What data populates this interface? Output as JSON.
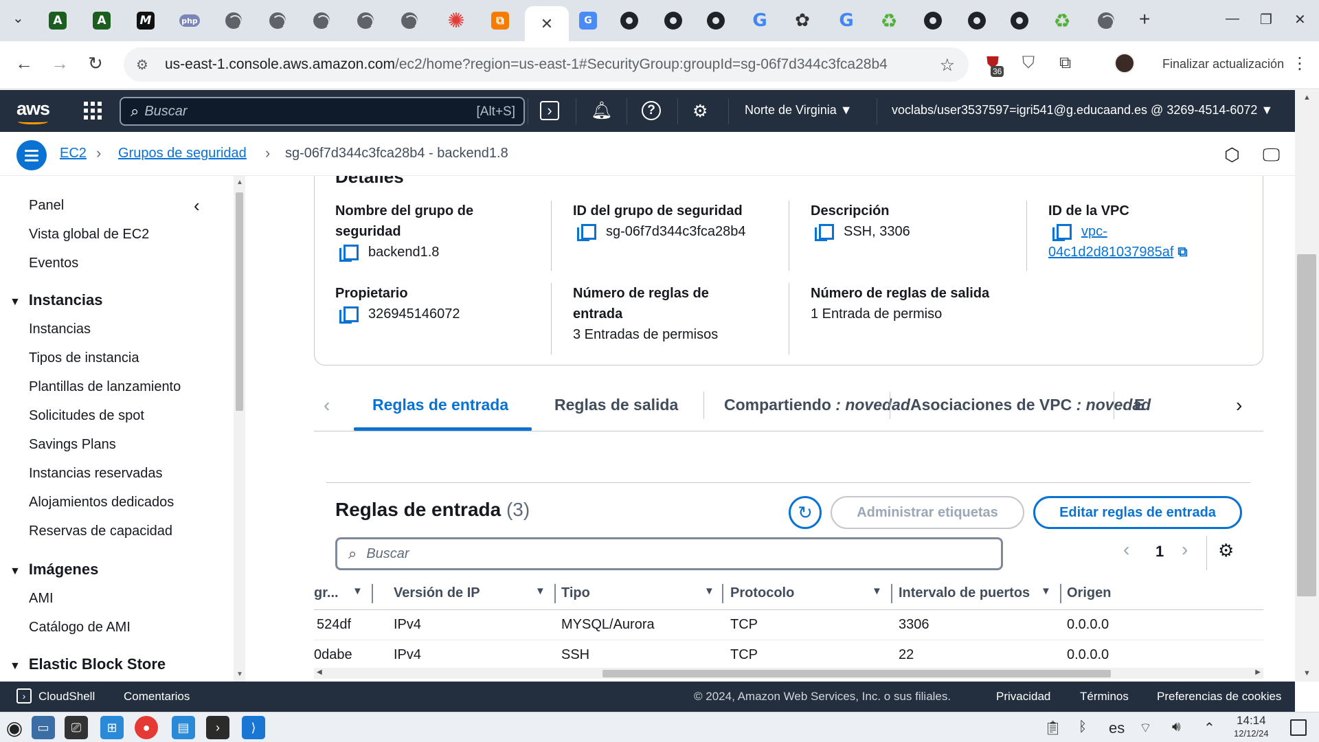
{
  "browser": {
    "tabs": [
      {
        "icon": "letter-a-green-icon",
        "text": "A"
      },
      {
        "icon": "letter-a-green-icon",
        "text": "A"
      },
      {
        "icon": "letter-m-icon",
        "text": "M"
      },
      {
        "icon": "php-icon",
        "text": "php"
      },
      {
        "icon": "globe-icon",
        "text": ""
      },
      {
        "icon": "globe-icon",
        "text": ""
      },
      {
        "icon": "globe-icon",
        "text": ""
      },
      {
        "icon": "globe-icon",
        "text": ""
      },
      {
        "icon": "globe-icon",
        "text": ""
      },
      {
        "icon": "red-gear-icon",
        "text": "✺"
      },
      {
        "icon": "orange-square-icon",
        "text": "⧉"
      }
    ],
    "active_tab_close": "✕",
    "url_host": "us-east-1.console.aws.amazon.com",
    "url_rest": "/ec2/home?region=us-east-1#SecurityGroup:groupId=sg-06f7d344c3fca28b4",
    "ext_badge": "36",
    "update_label": "Finalizar actualización"
  },
  "aws": {
    "logo": "aws",
    "search_placeholder": "Buscar",
    "search_shortcut": "[Alt+S]",
    "region": "Norte de Virginia ▼",
    "account": "voclabs/user3537597=igri541@g.educaand.es @ 3269-4514-6072 ▼"
  },
  "breadcrumb": {
    "ec2": "EC2",
    "groups": "Grupos de seguridad",
    "current": "sg-06f7d344c3fca28b4 - backend1.8"
  },
  "sidebar": {
    "items_top": [
      "Panel",
      "Vista global de EC2",
      "Eventos"
    ],
    "section_instances": "Instancias",
    "instances_items": [
      "Instancias",
      "Tipos de instancia",
      "Plantillas de lanzamiento",
      "Solicitudes de spot",
      "Savings Plans",
      "Instancias reservadas",
      "Alojamientos dedicados",
      "Reservas de capacidad"
    ],
    "section_images": "Imágenes",
    "images_items": [
      "AMI",
      "Catálogo de AMI"
    ],
    "section_ebs": "Elastic Block Store"
  },
  "details": {
    "heading": "Detalles",
    "name_label_1": "Nombre del grupo de",
    "name_label_2": "seguridad",
    "name_value": "backend1.8",
    "sgid_label": "ID del grupo de seguridad",
    "sgid_value": "sg-06f7d344c3fca28b4",
    "desc_label": "Descripción",
    "desc_value": "SSH, 3306",
    "vpc_label": "ID de la VPC",
    "vpc_value_1": "vpc-",
    "vpc_value_2": "04c1d2d81037985af",
    "owner_label": "Propietario",
    "owner_value": "326945146072",
    "inrules_label_1": "Número de reglas de",
    "inrules_label_2": "entrada",
    "inrules_value": "3 Entradas de permisos",
    "outrules_label": "Número de reglas de salida",
    "outrules_value": "1 Entrada de permiso"
  },
  "tabs": {
    "inbound": "Reglas de entrada",
    "outbound": "Reglas de salida",
    "sharing": "Compartiendo",
    "sharing_tag": ": novedad",
    "vpc_assoc": "Asociaciones de VPC",
    "vpc_assoc_tag": ": novedad",
    "cut": "E"
  },
  "rules": {
    "title": "Reglas de entrada",
    "count": "(3)",
    "manage_tags": "Administrar etiquetas",
    "edit_rules": "Editar reglas de entrada",
    "search_placeholder": "Buscar",
    "page": "1",
    "columns": [
      "gr...",
      "Versión de IP",
      "Tipo",
      "Protocolo",
      "Intervalo de puertos",
      "Origen"
    ],
    "rows": [
      [
        "524df",
        "IPv4",
        "MYSQL/Aurora",
        "TCP",
        "3306",
        "0.0.0.0"
      ],
      [
        "0dabe",
        "IPv4",
        "SSH",
        "TCP",
        "22",
        "0.0.0.0"
      ]
    ]
  },
  "footer": {
    "cloudshell": "CloudShell",
    "feedback": "Comentarios",
    "copyright": "© 2024, Amazon Web Services, Inc. o sus filiales.",
    "privacy": "Privacidad",
    "terms": "Términos",
    "cookies": "Preferencias de cookies"
  },
  "taskbar": {
    "lang": "es",
    "time": "14:14",
    "date": "12/12/24"
  }
}
